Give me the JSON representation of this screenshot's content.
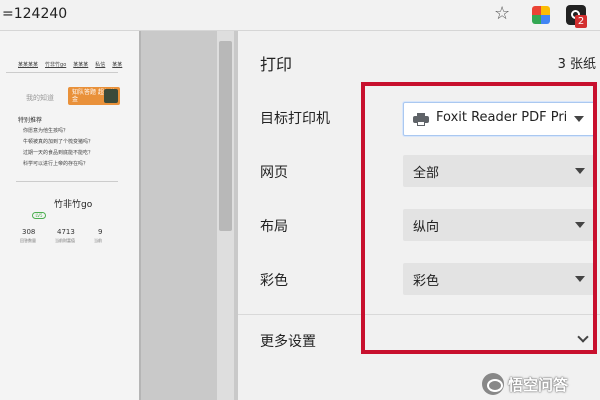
{
  "browser": {
    "url_fragment": "=124240",
    "star_icon": "star-icon",
    "extensions": [
      "colorful-extension-icon",
      "dark-extension-icon"
    ],
    "extension_badge": "2"
  },
  "preview": {
    "nav_links": [
      "某某某某",
      "竹非竹go",
      "某某某",
      "私信",
      "某某"
    ],
    "known_label": "我的知道",
    "ad_text": "知队答题 超级奖金",
    "recommend_title": "特别推荐",
    "questions": [
      "你愿意为他生孩吗？",
      "牛顿被真的加到了个梳变猪吗？",
      "过期一天的食品到底能不能吃？",
      "科学可以进行上帝的存在吗？"
    ],
    "username": "竹非竹go",
    "level": "LV5",
    "stats": [
      {
        "num": "308",
        "label": "回答数量"
      },
      {
        "num": "4713",
        "label": "当前财富值"
      },
      {
        "num": "9",
        "label": "当前"
      }
    ]
  },
  "panel": {
    "title": "打印",
    "page_count": "3 张纸",
    "destination_label": "目标打印机",
    "destination_value": "Foxit Reader PDF Printer",
    "pages_label": "网页",
    "pages_value": "全部",
    "layout_label": "布局",
    "layout_value": "纵向",
    "color_label": "彩色",
    "color_value": "彩色",
    "more_settings": "更多设置"
  },
  "colors": {
    "highlight": "#c8102e",
    "select_bg": "#e3e3e3",
    "panel_bg": "#f1f1f1"
  },
  "watermark": {
    "text": "悟空问答"
  }
}
